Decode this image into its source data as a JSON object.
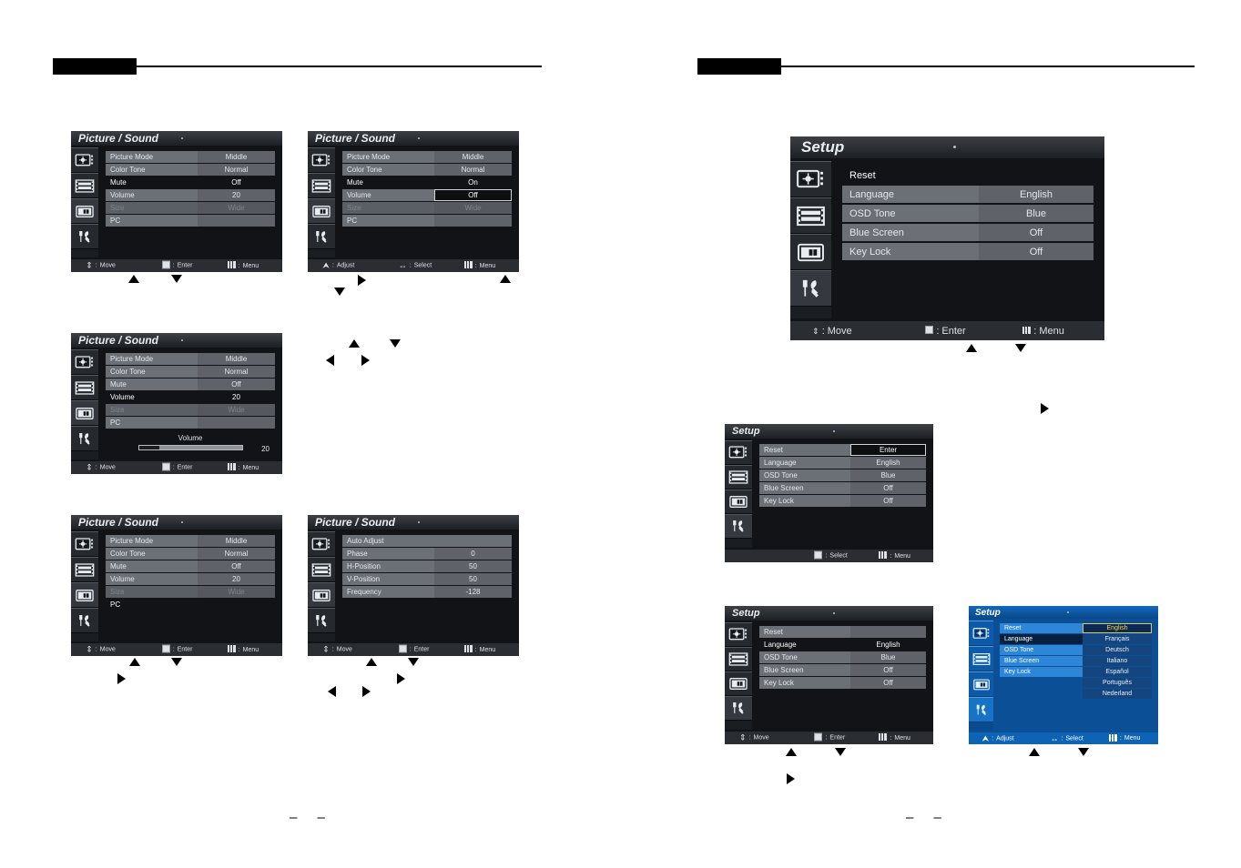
{
  "document": {
    "left_page_number": "– –",
    "right_page_number": "– –"
  },
  "footer_glyphs": {
    "move": "Move",
    "adjust": "Adjust",
    "enter": "Enter",
    "select": "Select",
    "menu": "Menu",
    "updown_icon": "up-down-arrow-icon",
    "leftright_icon": "left-right-arrow-icon",
    "square_icon": "square-button-icon",
    "menu_icon": "menu-button-icon"
  },
  "sidebar_icons": [
    {
      "name": "picture-settings-icon"
    },
    {
      "name": "sound-settings-icon"
    },
    {
      "name": "screen-format-icon"
    },
    {
      "name": "setup-tools-icon"
    }
  ],
  "menus": {
    "picture_sound_1": {
      "title": "Picture / Sound",
      "rows": [
        {
          "label": "Picture Mode",
          "value": "Middle",
          "state": "normal"
        },
        {
          "label": "Color Tone",
          "value": "Normal",
          "state": "normal"
        },
        {
          "label": "Mute",
          "value": "Off",
          "state": "selected"
        },
        {
          "label": "Volume",
          "value": "20",
          "state": "normal"
        },
        {
          "label": "Size",
          "value": "Wide",
          "state": "disabled"
        },
        {
          "label": "PC",
          "value": "",
          "state": "normal"
        }
      ],
      "footer": {
        "nav": "Move",
        "action": "Enter",
        "exit": "Menu"
      },
      "active_sidebar": 2
    },
    "picture_sound_2": {
      "title": "Picture / Sound",
      "rows": [
        {
          "label": "Picture Mode",
          "value": "Middle",
          "state": "normal"
        },
        {
          "label": "Color Tone",
          "value": "Normal",
          "state": "normal"
        },
        {
          "label": "Mute",
          "value": "On",
          "state": "selected"
        },
        {
          "label": "Volume",
          "value": "Off",
          "state": "valuebox"
        },
        {
          "label": "Size",
          "value": "Wide",
          "state": "disabled"
        },
        {
          "label": "PC",
          "value": "",
          "state": "normal"
        }
      ],
      "footer": {
        "nav": "Adjust",
        "action": "Select",
        "exit": "Menu"
      },
      "active_sidebar": 2
    },
    "picture_sound_3": {
      "title": "Picture / Sound",
      "rows": [
        {
          "label": "Picture Mode",
          "value": "Middle",
          "state": "normal"
        },
        {
          "label": "Color Tone",
          "value": "Normal",
          "state": "normal"
        },
        {
          "label": "Mute",
          "value": "Off",
          "state": "normal"
        },
        {
          "label": "Volume",
          "value": "20",
          "state": "selected"
        },
        {
          "label": "Size",
          "value": "Wide",
          "state": "disabled"
        },
        {
          "label": "PC",
          "value": "",
          "state": "normal"
        }
      ],
      "slider": {
        "title": "Volume",
        "value": "20",
        "percent": 20
      },
      "footer": {
        "nav": "Move",
        "action": "Enter",
        "exit": "Menu"
      },
      "active_sidebar": 2
    },
    "picture_sound_4": {
      "title": "Picture / Sound",
      "rows": [
        {
          "label": "Picture Mode",
          "value": "Middle",
          "state": "normal"
        },
        {
          "label": "Color Tone",
          "value": "Normal",
          "state": "normal"
        },
        {
          "label": "Mute",
          "value": "Off",
          "state": "normal"
        },
        {
          "label": "Volume",
          "value": "20",
          "state": "normal"
        },
        {
          "label": "Size",
          "value": "Wide",
          "state": "disabled"
        },
        {
          "label": "PC",
          "value": "",
          "state": "selected-full"
        }
      ],
      "footer": {
        "nav": "Move",
        "action": "Enter",
        "exit": "Menu"
      },
      "active_sidebar": 2
    },
    "pc_submenu": {
      "title": "Picture / Sound",
      "rows": [
        {
          "label": "Auto Adjust",
          "value": "",
          "state": "header-full"
        },
        {
          "label": "Phase",
          "value": "0",
          "state": "normal"
        },
        {
          "label": "H-Position",
          "value": "50",
          "state": "normal"
        },
        {
          "label": "V-Position",
          "value": "50",
          "state": "normal"
        },
        {
          "label": "Frequency",
          "value": "-128",
          "state": "normal"
        }
      ],
      "footer": {
        "nav": "Move",
        "action": "Enter",
        "exit": "Menu"
      },
      "active_sidebar": 2
    },
    "setup_large": {
      "title": "Setup",
      "rows": [
        {
          "label": "Reset",
          "value": "",
          "state": "selected-full"
        },
        {
          "label": "Language",
          "value": "English",
          "state": "normal"
        },
        {
          "label": "OSD Tone",
          "value": "Blue",
          "state": "normal"
        },
        {
          "label": "Blue Screen",
          "value": "Off",
          "state": "normal"
        },
        {
          "label": "Key Lock",
          "value": "Off",
          "state": "normal"
        }
      ],
      "footer": {
        "nav": "Move",
        "action": "Enter",
        "exit": "Menu"
      },
      "active_sidebar": 3
    },
    "setup_reset": {
      "title": "Setup",
      "rows": [
        {
          "label": "Reset",
          "value": "Enter",
          "state": "valuebox"
        },
        {
          "label": "Language",
          "value": "English",
          "state": "normal"
        },
        {
          "label": "OSD Tone",
          "value": "Blue",
          "state": "normal"
        },
        {
          "label": "Blue Screen",
          "value": "Off",
          "state": "normal"
        },
        {
          "label": "Key Lock",
          "value": "Off",
          "state": "normal"
        }
      ],
      "footer": {
        "nav": "",
        "action": "Select",
        "exit": "Menu"
      },
      "active_sidebar": 3
    },
    "setup_language": {
      "title": "Setup",
      "rows": [
        {
          "label": "Reset",
          "value": "",
          "state": "normal"
        },
        {
          "label": "Language",
          "value": "English",
          "state": "selected"
        },
        {
          "label": "OSD Tone",
          "value": "Blue",
          "state": "normal"
        },
        {
          "label": "Blue Screen",
          "value": "Off",
          "state": "normal"
        },
        {
          "label": "Key Lock",
          "value": "Off",
          "state": "normal"
        }
      ],
      "footer": {
        "nav": "Move",
        "action": "Enter",
        "exit": "Menu"
      },
      "active_sidebar": 3
    },
    "setup_language_list": {
      "title": "Setup",
      "theme": "blue",
      "rows": [
        {
          "label": "Reset",
          "state": "normal"
        },
        {
          "label": "Language",
          "state": "selected"
        },
        {
          "label": "OSD Tone",
          "state": "normal"
        },
        {
          "label": "Blue Screen",
          "state": "normal"
        },
        {
          "label": "Key Lock",
          "state": "normal"
        }
      ],
      "options": [
        {
          "label": "English",
          "selected": true
        },
        {
          "label": "Français",
          "selected": false
        },
        {
          "label": "Deutsch",
          "selected": false
        },
        {
          "label": "Italiano",
          "selected": false
        },
        {
          "label": "Español",
          "selected": false
        },
        {
          "label": "Português",
          "selected": false
        },
        {
          "label": "Nederland",
          "selected": false
        }
      ],
      "footer": {
        "nav": "Adjust",
        "action": "Select",
        "exit": "Menu"
      },
      "active_sidebar": 3
    }
  },
  "colors": {
    "osd_background": "#111316",
    "osd_row_label": "#6b7076",
    "osd_row_value": "#5f6369",
    "osd_blue_background": "#0b4f96",
    "osd_blue_row_label": "#2e86d8",
    "option_highlight_text": "#ffd24d"
  }
}
